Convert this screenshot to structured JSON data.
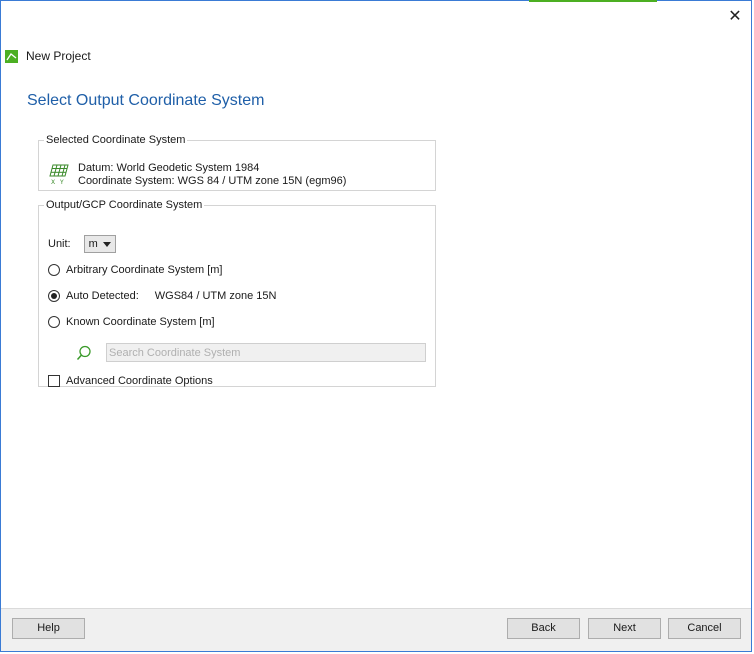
{
  "window": {
    "title": "New Project",
    "close_glyph": "✕"
  },
  "page": {
    "heading": "Select Output Coordinate System"
  },
  "selected_cs": {
    "legend": "Selected Coordinate System",
    "icon": "coordinate-grid-icon",
    "datum": "Datum: World Geodetic System 1984",
    "coordinate_system": "Coordinate System: WGS 84 / UTM zone 15N (egm96)"
  },
  "output_cs": {
    "legend": "Output/GCP Coordinate System",
    "unit_label": "Unit:",
    "unit_value": "m",
    "options": [
      {
        "label": "Arbitrary Coordinate System [m]",
        "checked": false
      },
      {
        "label": "Auto Detected:",
        "value": "WGS84 / UTM zone 15N",
        "checked": true
      },
      {
        "label": "Known Coordinate System [m]",
        "checked": false
      }
    ],
    "search": {
      "icon": "search-icon",
      "placeholder": "Search Coordinate System",
      "value": ""
    },
    "advanced_label": "Advanced Coordinate Options",
    "advanced_checked": false
  },
  "footer": {
    "help": "Help",
    "back": "Back",
    "next": "Next",
    "cancel": "Cancel"
  },
  "colors": {
    "heading": "#1f5fa8",
    "accent_green": "#4caf22",
    "search_icon": "#3a9a2a"
  }
}
